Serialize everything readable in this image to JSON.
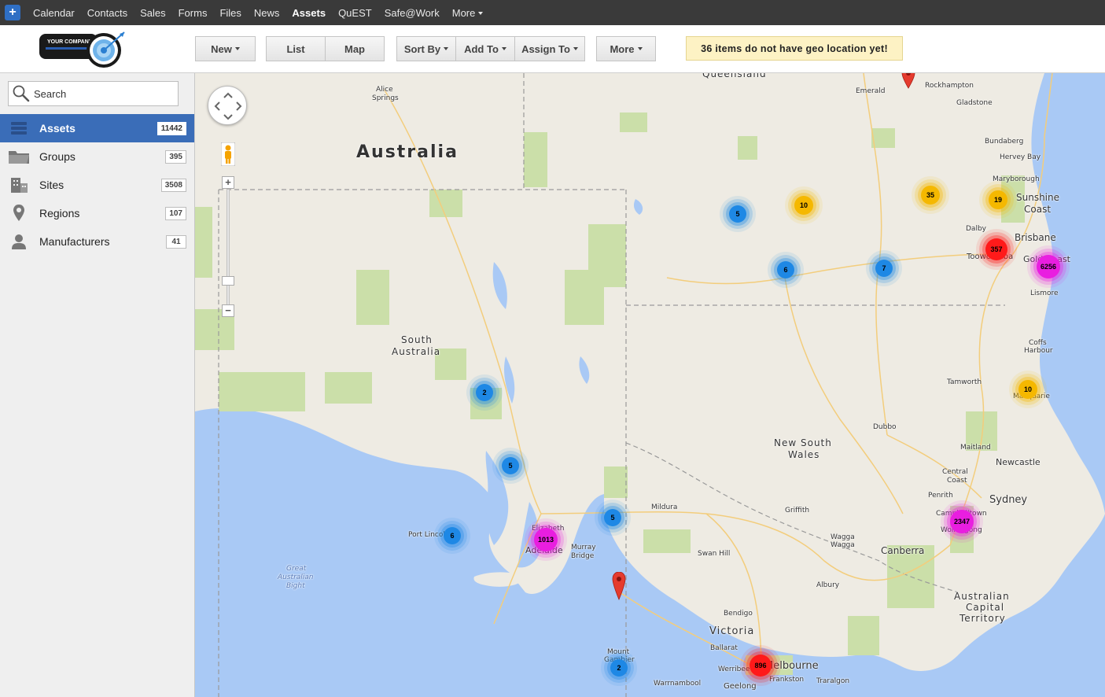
{
  "topnav": {
    "plus": "+",
    "items": [
      {
        "label": "Calendar"
      },
      {
        "label": "Contacts"
      },
      {
        "label": "Sales"
      },
      {
        "label": "Forms"
      },
      {
        "label": "Files"
      },
      {
        "label": "News"
      },
      {
        "label": "Assets",
        "active": true
      },
      {
        "label": "QuEST"
      },
      {
        "label": "Safe@Work"
      },
      {
        "label": "More"
      }
    ]
  },
  "logo": {
    "text": "YOUR COMPANY"
  },
  "toolbar": {
    "new": "New",
    "list": "List",
    "map": "Map",
    "sort_by": "Sort By",
    "add_to": "Add To",
    "assign_to": "Assign To",
    "more": "More",
    "geo_warning": "36 items do not have geo location yet!"
  },
  "sidebar": {
    "search_placeholder": "Search",
    "items": [
      {
        "label": "Assets",
        "count": "11442",
        "icon": "list-icon",
        "active": true
      },
      {
        "label": "Groups",
        "count": "395",
        "icon": "folder-icon"
      },
      {
        "label": "Sites",
        "count": "3508",
        "icon": "building-icon"
      },
      {
        "label": "Regions",
        "count": "107",
        "icon": "map-pin-icon"
      },
      {
        "label": "Manufacturers",
        "count": "41",
        "icon": "person-icon"
      }
    ]
  },
  "map": {
    "labels": {
      "queensland": "Queensland",
      "australia": "Australia",
      "south_australia_1": "South",
      "south_australia_2": "Australia",
      "nsw_1": "New South",
      "nsw_2": "Wales",
      "victoria": "Victoria",
      "act_1": "Australian",
      "act_2": "Capital",
      "act_3": "Territory",
      "great_bight_1": "Great",
      "great_bight_2": "Australian",
      "great_bight_3": "Bight",
      "alice_1": "Alice",
      "alice_2": "Springs",
      "emerald": "Emerald",
      "rockhampton": "Rockhampton",
      "gladstone": "Gladstone",
      "bundaberg": "Bundaberg",
      "hervey_bay": "Hervey Bay",
      "maryborough": "Maryborough",
      "sunshine_1": "Sunshine",
      "sunshine_2": "Coast",
      "dalby": "Dalby",
      "brisbane": "Brisbane",
      "toowoomba": "Toowoomba",
      "gold_coast": "Gold Coast",
      "lismore": "Lismore",
      "coffs_1": "Coffs",
      "coffs_2": "Harbour",
      "tamworth": "Tamworth",
      "port_macquarie": "Macquarie",
      "dubbo": "Dubbo",
      "maitland": "Maitland",
      "newcastle": "Newcastle",
      "central_1": "Central",
      "central_2": "Coast",
      "penrith": "Penrith",
      "sydney": "Sydney",
      "wollongong": "Wollongong",
      "campbelltown": "Campbelltown",
      "griffith": "Griffith",
      "wagga_1": "Wagga",
      "wagga_2": "Wagga",
      "canberra": "Canberra",
      "albury": "Albury",
      "mildura": "Mildura",
      "swan_hill": "Swan Hill",
      "bendigo": "Bendigo",
      "ballarat": "Ballarat",
      "melbourne": "Melbourne",
      "werribee": "Werribee",
      "frankston": "Frankston",
      "traralgon": "Traralgon",
      "geelong": "Geelong",
      "warrnambool": "Warrnambool",
      "mount_1": "Mount",
      "mount_2": "Gambier",
      "murray_1": "Murray",
      "murray_2": "Bridge",
      "adelaide": "Adelaide",
      "elizabeth": "Elizabeth",
      "port_lincoln": "Port Lincoln"
    },
    "clusters": [
      {
        "count": "5",
        "level": "blue"
      },
      {
        "count": "10",
        "level": "yellow"
      },
      {
        "count": "35",
        "level": "yellow"
      },
      {
        "count": "19",
        "level": "yellow"
      },
      {
        "count": "357",
        "level": "red"
      },
      {
        "count": "6256",
        "level": "magenta"
      },
      {
        "count": "6",
        "level": "blue"
      },
      {
        "count": "7",
        "level": "blue"
      },
      {
        "count": "2",
        "level": "blue"
      },
      {
        "count": "10",
        "level": "yellow"
      },
      {
        "count": "5",
        "level": "blue"
      },
      {
        "count": "5",
        "level": "blue"
      },
      {
        "count": "1013",
        "level": "magenta"
      },
      {
        "count": "6",
        "level": "blue"
      },
      {
        "count": "2347",
        "level": "magenta"
      },
      {
        "count": "896",
        "level": "red"
      },
      {
        "count": "2",
        "level": "blue"
      }
    ],
    "colors": {
      "blue": "#1e88e5",
      "yellow": "#f5b800",
      "red": "#ff1a1a",
      "magenta": "#e91ee0",
      "water": "#a9c9f5",
      "land": "#eeebe3",
      "park": "#cbdfa9"
    },
    "zoom_in": "+",
    "zoom_out": "−"
  }
}
